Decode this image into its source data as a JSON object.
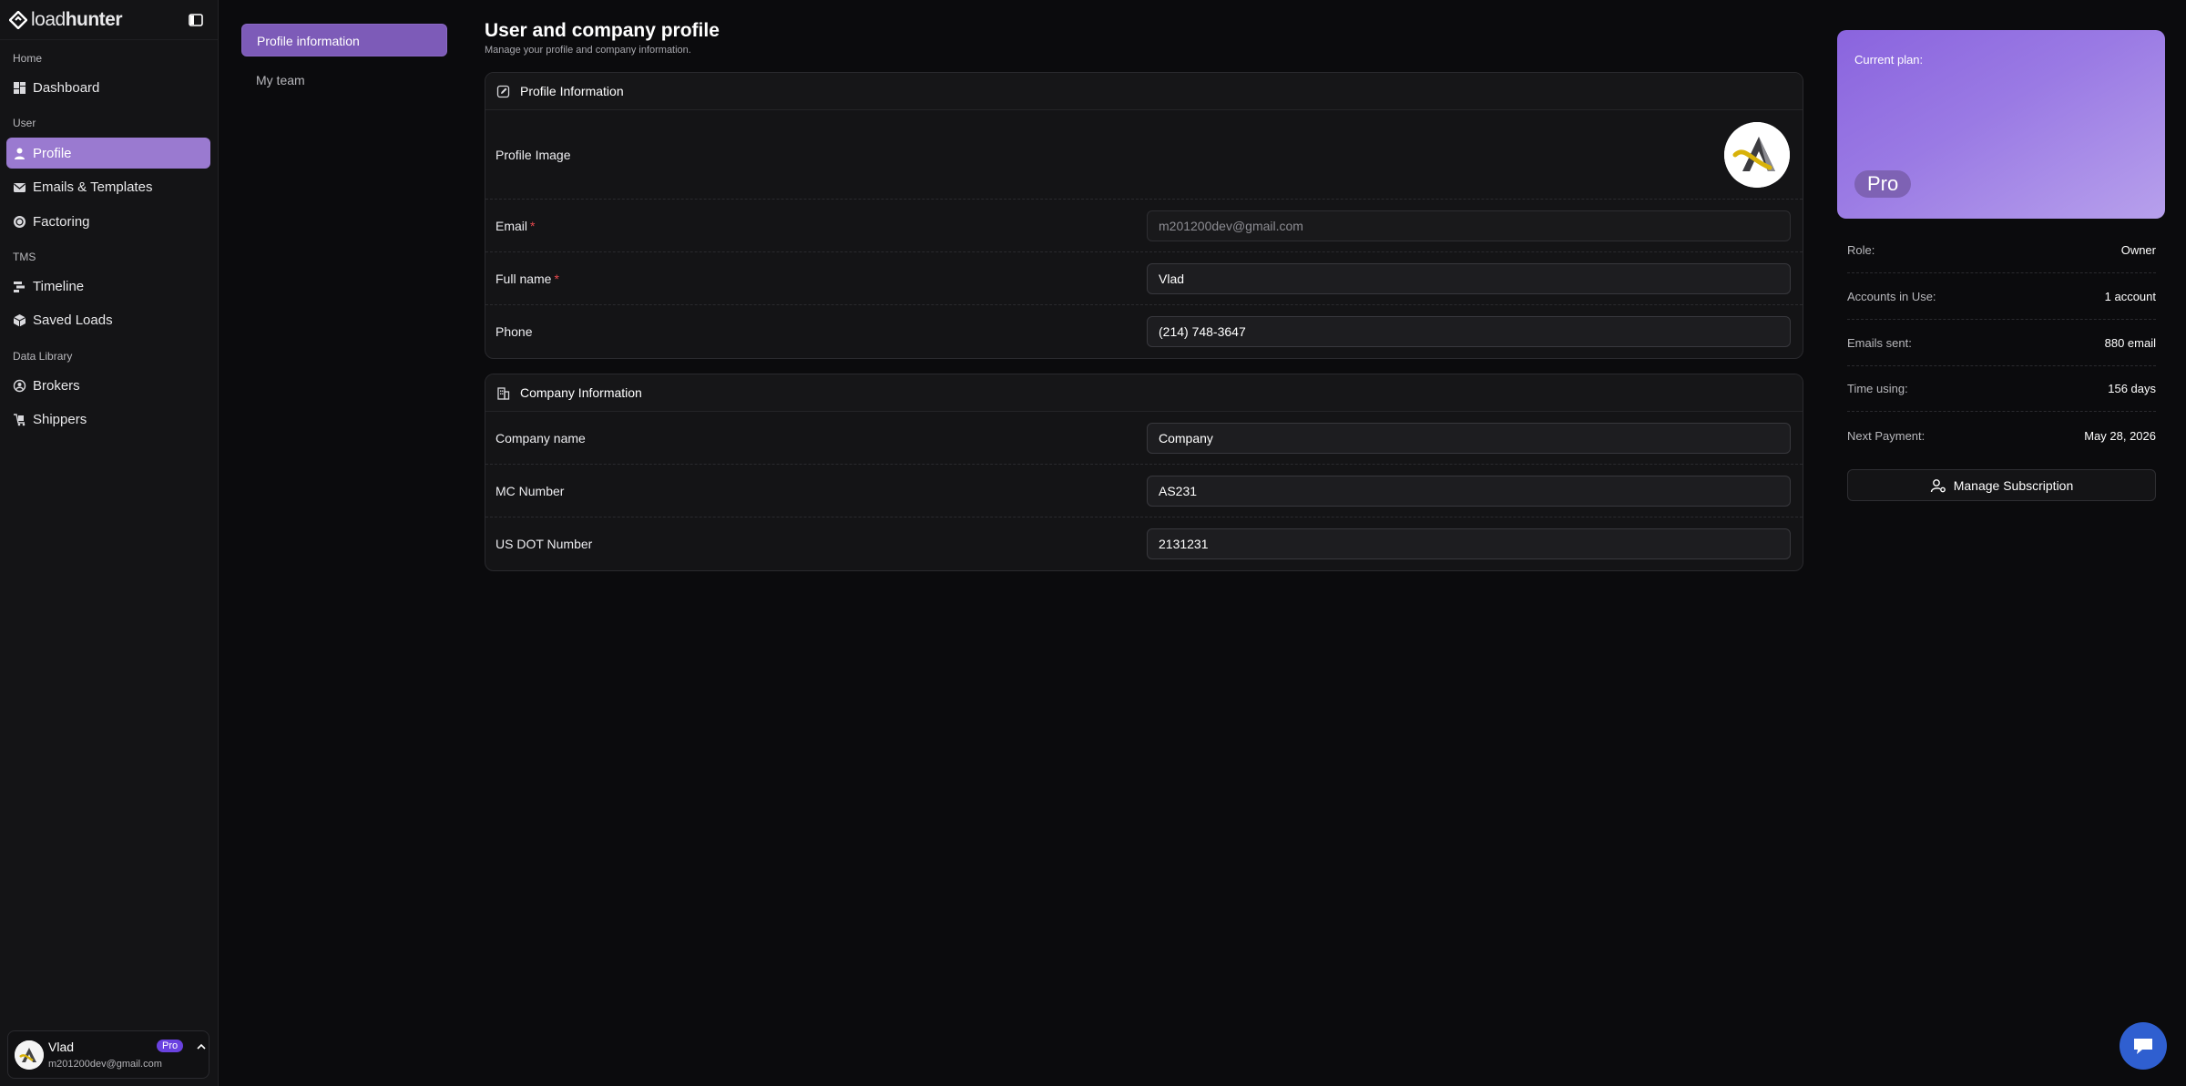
{
  "brand": {
    "name_light": "load",
    "name_bold": "hunter"
  },
  "sidebar": {
    "groups": [
      {
        "label": "Home"
      },
      {
        "label": "User"
      },
      {
        "label": "TMS"
      },
      {
        "label": "Data Library"
      }
    ],
    "items": [
      {
        "label": "Dashboard",
        "icon": "dashboard-icon"
      },
      {
        "label": "Profile",
        "icon": "user-icon",
        "active": true
      },
      {
        "label": "Emails & Templates",
        "icon": "mail-icon"
      },
      {
        "label": "Factoring",
        "icon": "coin-icon"
      },
      {
        "label": "Timeline",
        "icon": "timeline-icon"
      },
      {
        "label": "Saved Loads",
        "icon": "box-icon"
      },
      {
        "label": "Brokers",
        "icon": "broker-icon"
      },
      {
        "label": "Shippers",
        "icon": "shipper-icon"
      }
    ],
    "user": {
      "name": "Vlad",
      "email": "m201200dev@gmail.com",
      "badge": "Pro"
    }
  },
  "subnav": {
    "items": [
      {
        "label": "Profile information",
        "active": true
      },
      {
        "label": "My team"
      }
    ]
  },
  "page": {
    "title": "User and company profile",
    "subtitle": "Manage your profile and company information."
  },
  "profile_card": {
    "title": "Profile Information",
    "image_label": "Profile Image",
    "email_label": "Email",
    "email_value": "m201200dev@gmail.com",
    "fullname_label": "Full name",
    "fullname_value": "Vlad",
    "phone_label": "Phone",
    "phone_value": "(214) 748-3647",
    "required_mark": "*"
  },
  "company_card": {
    "title": "Company Information",
    "company_label": "Company name",
    "company_value": "Company",
    "mc_label": "MC Number",
    "mc_value": "AS231",
    "dot_label": "US DOT Number",
    "dot_value": "2131231"
  },
  "plan": {
    "label": "Current plan:",
    "name": "Pro",
    "stats": [
      {
        "key": "Role:",
        "value": "Owner"
      },
      {
        "key": "Accounts in Use:",
        "value": "1 account"
      },
      {
        "key": "Emails sent:",
        "value": "880 email"
      },
      {
        "key": "Time using:",
        "value": "156 days"
      },
      {
        "key": "Next Payment:",
        "value": "May 28, 2026"
      }
    ],
    "manage_label": "Manage Subscription"
  },
  "colors": {
    "accent": "#9a7ad0",
    "plan_gradient_start": "#8a64de",
    "required": "#e5484d",
    "chat": "#2f5fd0"
  }
}
